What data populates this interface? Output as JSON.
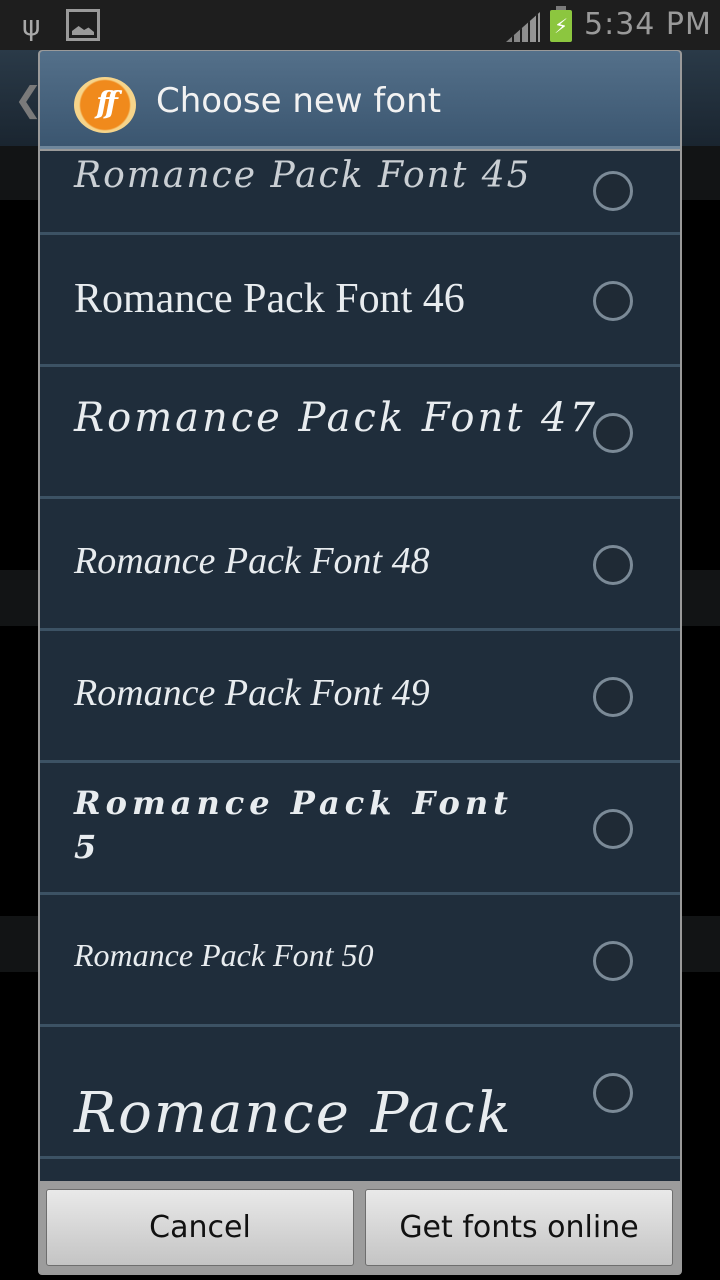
{
  "status_bar": {
    "left_icons": [
      "usb-icon",
      "image-icon"
    ],
    "right_icons": [
      "signal-icon",
      "battery-charging-icon"
    ],
    "time": "5:34 PM",
    "colors": {
      "background": "#1e1e1e",
      "battery": "#8cc63f"
    }
  },
  "dialog": {
    "logo": {
      "icon": "ff-logo-icon",
      "text": "ff"
    },
    "title": "Choose new font",
    "fonts": [
      {
        "label": "Romance Pack Font 45",
        "selected": false,
        "partial": true
      },
      {
        "label": "Romance Pack Font 46",
        "selected": false
      },
      {
        "label": "Romance Pack Font 47",
        "selected": false
      },
      {
        "label": "Romance Pack Font 48",
        "selected": false
      },
      {
        "label": "Romance Pack Font 49",
        "selected": false
      },
      {
        "label": "Romance Pack Font 5",
        "selected": false
      },
      {
        "label": "Romance Pack Font 50",
        "selected": false
      },
      {
        "label": "Romance Pack",
        "selected": false,
        "partial": true
      }
    ],
    "buttons": {
      "cancel": "Cancel",
      "get_fonts_online": "Get fonts online"
    },
    "colors": {
      "title_bar": "#4a657f",
      "list_background": "#1f2d3b",
      "divider": "#3c5264",
      "button_bar": "#9c9c9c"
    }
  }
}
